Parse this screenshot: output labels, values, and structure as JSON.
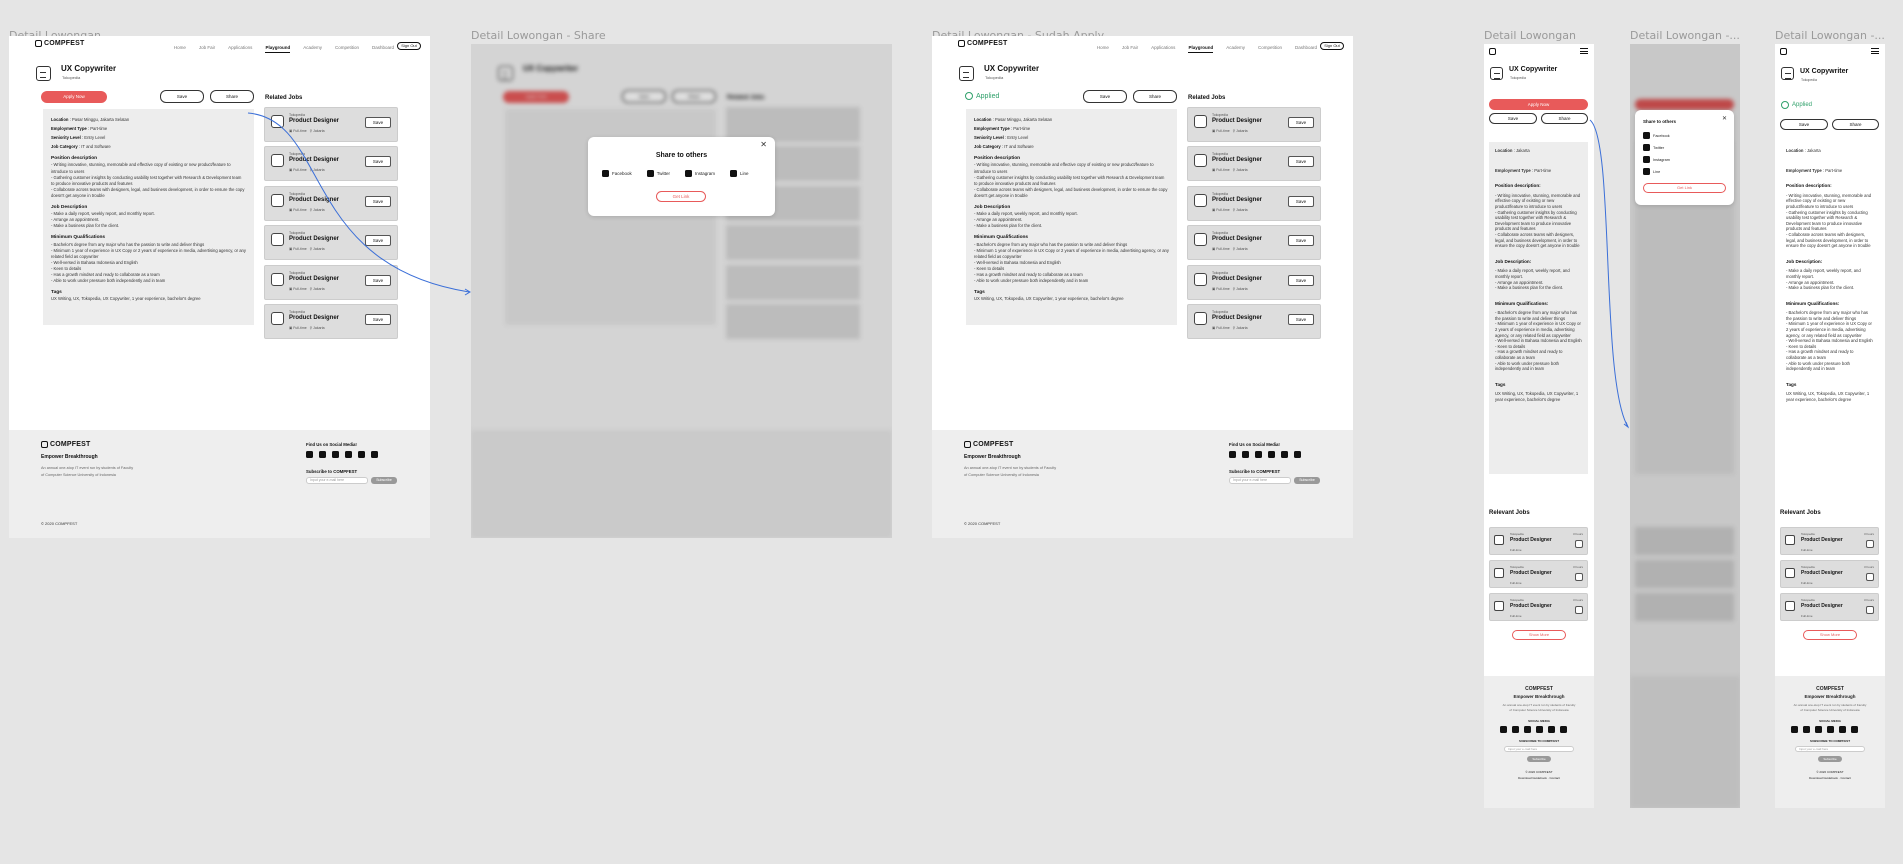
{
  "frames": {
    "f1": "Detail Lowongan",
    "f2": "Detail Lowongan - Share",
    "f3": "Detail Lowongan - Sudah Apply",
    "f4": "Detail Lowongan",
    "f5": "Detail Lowongan -...",
    "f6": "Detail Lowongan -..."
  },
  "brand": {
    "logo_text": "COMPFEST",
    "tagline": "Empower Breakthrough",
    "description_1": "An annual one-stop IT event run by students of Faculty",
    "description_2": "of Computer Science University of Indonesia",
    "copyright": "© 2020 COMPFEST",
    "accent": "#e85a5a",
    "applied_color": "#2fa06a"
  },
  "nav": {
    "items": [
      "Home",
      "Job Fair",
      "Applications",
      "Playground",
      "Academy",
      "Competition",
      "Dashboard"
    ],
    "active": "Playground",
    "signout": "Sign Out"
  },
  "job": {
    "title": "UX Copywriter",
    "company": "Tokopedia",
    "apply_label": "Apply Now",
    "applied_label": "Applied",
    "save_label": "Save",
    "share_label": "Share",
    "location_label": "Location",
    "location": ": Pasar Minggu, Jakarta Selatan",
    "location_short": ": Jakarta",
    "employment_label": "Employment Type",
    "employment": ": Part-time",
    "seniority_label": "Seniority Level",
    "seniority": ": Entry Level",
    "category_label": "Job Category",
    "category": ": IT and Software",
    "position_heading": "Position description",
    "position_heading_mobile": "Position description:",
    "position_items": [
      "- Writing innovative, stunning, memorable and effective copy of existing or new product/feature to introduce to users",
      "- Gathering customer insights by conducting usability test together with Research & Development team to produce innovative products and features",
      "- Collaborate across teams with designers, legal, and business development, in order to ensure the copy doesn't get anyone in trouble"
    ],
    "jobdesc_heading": "Job Description",
    "jobdesc_heading_mobile": "Job Description:",
    "jobdesc_items": [
      "- Make a daily report, weekly report, and monthly report.",
      "- Arrange an appointment.",
      "- Make a business plan for the client."
    ],
    "minimum_heading": "Minimum Qualifications",
    "minimum_heading_mobile": "Minimum Qualifications:",
    "minimum_items": [
      "- Bachelor's degree from any major who has the passion to write and deliver things",
      "- Minimum 1 year of experience in UX Copy or 2 years of experience in media, advertising agency, or any related field as copywriter",
      "- Well-versed in Bahasa Indonesia and English",
      "- Keen to details",
      "- Has a growth mindset and ready to collaborate as a team",
      "- Able to work under pressure both independently and in team"
    ],
    "tags_heading": "Tags",
    "tags": "UX Writing, UX, Tokopedia, UX Copywriter, 1 year experience, bachelor's degree"
  },
  "related": {
    "title": "Related Jobs",
    "title_mobile": "Relevant Jobs",
    "company": "Tokopedia",
    "job": "Product Designer",
    "type": "Full-time",
    "location": "Jakarta",
    "time": "3 hours",
    "save": "Save",
    "show_more": "Show More"
  },
  "share": {
    "title": "Share to others",
    "options": [
      "Facebook",
      "Twitter",
      "Instagram",
      "Line"
    ],
    "get_link": "Get Link"
  },
  "footer": {
    "find_us": "Find Us on Social Media!",
    "social_media": "SOCIAL MEDIA",
    "subscribe": "Subscribe to COMPFEST",
    "subscribe_mobile": "SUBSCRIBE TO COMPFEST",
    "email_placeholder": "Input your e-mail here",
    "subscribe_btn": "Subscribe",
    "links": "Download Guidebook · Contact"
  }
}
